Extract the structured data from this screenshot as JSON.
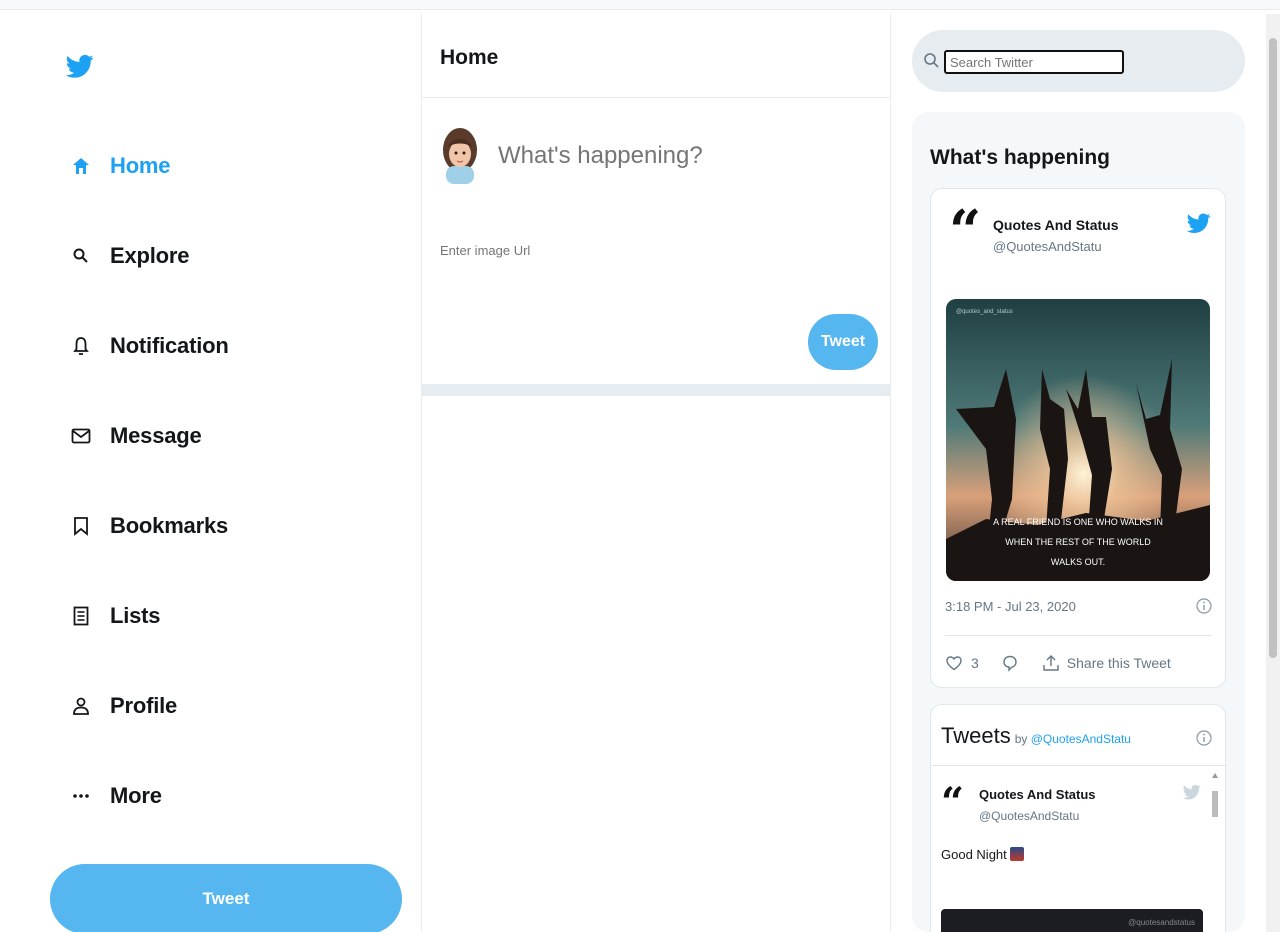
{
  "sidebar": {
    "items": [
      {
        "label": "Home",
        "icon": "home-icon",
        "active": true
      },
      {
        "label": "Explore",
        "icon": "search-icon"
      },
      {
        "label": "Notification",
        "icon": "bell-icon"
      },
      {
        "label": "Message",
        "icon": "mail-icon"
      },
      {
        "label": "Bookmarks",
        "icon": "bookmark-icon"
      },
      {
        "label": "Lists",
        "icon": "list-icon"
      },
      {
        "label": "Profile",
        "icon": "user-icon"
      },
      {
        "label": "More",
        "icon": "more-icon"
      }
    ],
    "tweet_button": "Tweet"
  },
  "center": {
    "title": "Home",
    "composer": {
      "placeholder": "What's happening?",
      "image_url_placeholder": "Enter image Url",
      "tweet_button": "Tweet"
    }
  },
  "right": {
    "search": {
      "placeholder": "Search Twitter"
    },
    "trends_title": "What's happening",
    "embed": {
      "name": "Quotes And Status",
      "handle": "@QuotesAndStatu",
      "image_caption_line1": "A REAL FRIEND IS ONE WHO WALKS IN",
      "image_caption_line2": "WHEN THE REST OF THE WORLD",
      "image_caption_line3": "WALKS OUT.",
      "image_watermark": "@quotes_and_status",
      "time": "3:18 PM - Jul 23, 2020",
      "likes": "3",
      "share_label": "Share this Tweet"
    },
    "timeline": {
      "title": "Tweets",
      "by_prefix": "by",
      "by_handle": "@QuotesAndStatu",
      "tweet": {
        "name": "Quotes And Status",
        "handle": "@QuotesAndStatu",
        "text": "Good Night"
      },
      "media_watermark": "@quotesandstatus"
    }
  },
  "colors": {
    "brand": "#1da1f2",
    "button": "#55b6f0",
    "panel": "#f5f8fa",
    "search_bg": "#e6ecf0"
  }
}
